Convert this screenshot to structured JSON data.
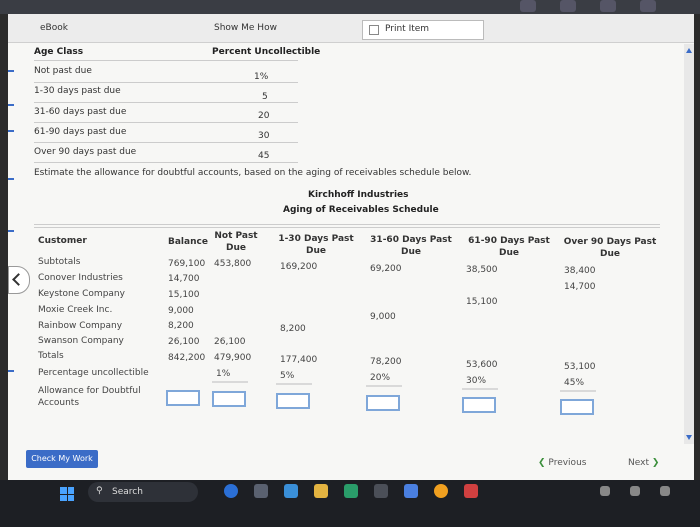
{
  "tabs": {
    "ebook": "eBook",
    "show_me_how": "Show Me How",
    "print_item": "Print Item"
  },
  "age_table": {
    "header_age": "Age Class",
    "header_percent": "Percent Uncollectible",
    "rows": [
      {
        "label": "Not past due",
        "value": "1%"
      },
      {
        "label": "1-30 days past due",
        "value": "5"
      },
      {
        "label": "31-60 days past due",
        "value": "20"
      },
      {
        "label": "61-90 days past due",
        "value": "30"
      },
      {
        "label": "Over 90 days past due",
        "value": "45"
      }
    ]
  },
  "instruction": "Estimate the allowance for doubtful accounts, based on the aging of receivables schedule below.",
  "company": "Kirchhoff Industries",
  "schedule_title": "Aging of Receivables Schedule",
  "schedule": {
    "headers": {
      "customer": "Customer",
      "balance": "Balance",
      "not_past_due": "Not Past Due",
      "d1_30": "1-30 Days Past Due",
      "d31_60": "31-60 Days Past Due",
      "d61_90": "61-90 Days Past Due",
      "over90": "Over 90 Days Past Due"
    },
    "subtotals": {
      "label": "Subtotals",
      "balance": "769,100",
      "not_past_due": "453,800",
      "d1_30": "169,200",
      "d31_60": "69,200",
      "d61_90": "38,500",
      "over90": "38,400"
    },
    "customers": [
      {
        "name": "Conover Industries",
        "balance": "14,700",
        "over90": "14,700"
      },
      {
        "name": "Keystone Company",
        "balance": "15,100",
        "d61_90": "15,100"
      },
      {
        "name": "Moxie Creek Inc.",
        "balance": "9,000",
        "d31_60": "9,000"
      },
      {
        "name": "Rainbow Company",
        "balance": "8,200",
        "d1_30": "8,200"
      },
      {
        "name": "Swanson Company",
        "balance": "26,100",
        "not_past_due": "26,100"
      }
    ],
    "totals": {
      "label": "Totals",
      "balance": "842,200",
      "not_past_due": "479,900",
      "d1_30": "177,400",
      "d31_60": "78,200",
      "d61_90": "53,600",
      "over90": "53,100"
    },
    "percentage": {
      "label": "Percentage uncollectible",
      "not_past_due": "1%",
      "d1_30": "5%",
      "d31_60": "20%",
      "d61_90": "30%",
      "over90": "45%"
    },
    "allowance_label": "Allowance for Doubtful Accounts"
  },
  "buttons": {
    "check_my_work": "Check My Work",
    "previous": "Previous",
    "next": "Next"
  },
  "taskbar": {
    "search_label": "Search"
  },
  "colors": {
    "accent": "#3b6cc7",
    "input_border": "#7fa7d9"
  }
}
